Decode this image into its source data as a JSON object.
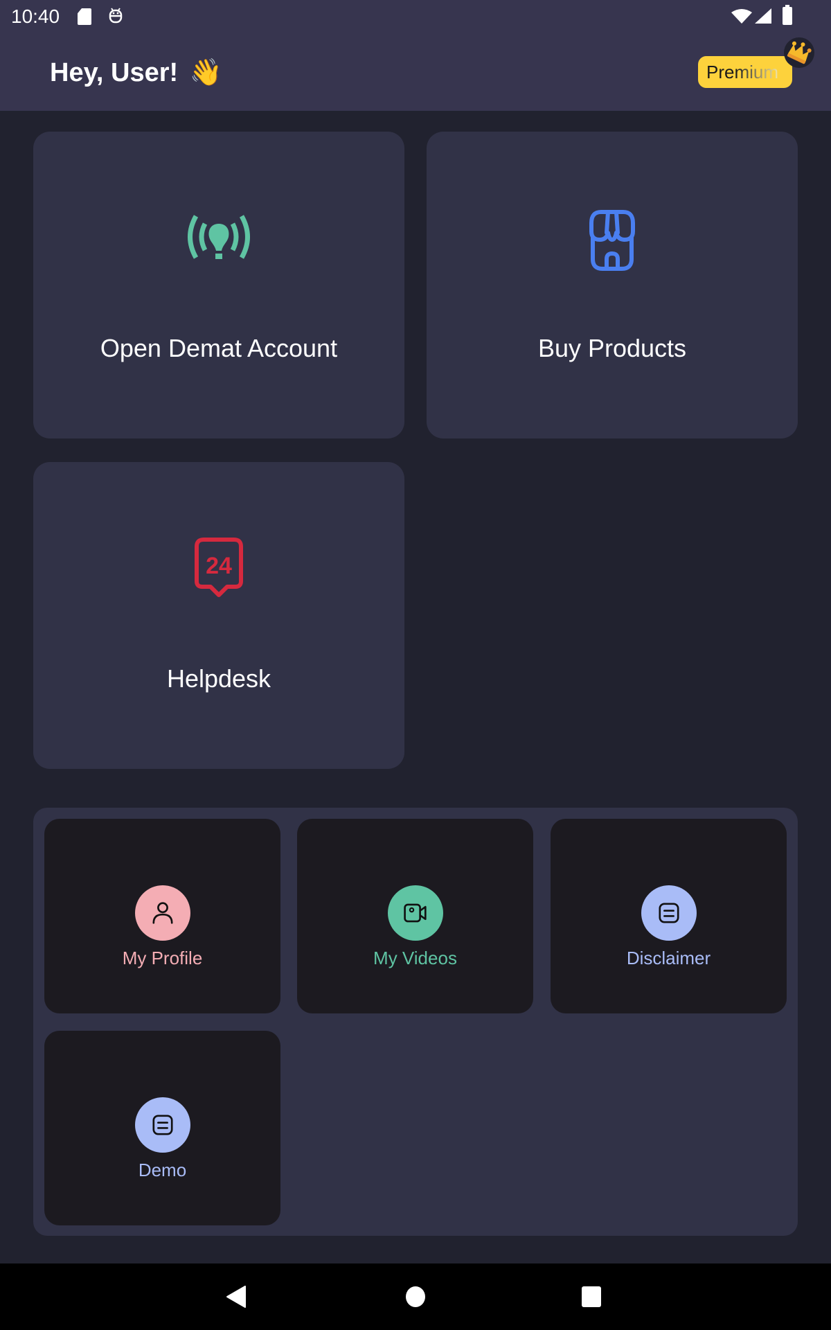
{
  "status_bar": {
    "time": "10:40",
    "icons": [
      "sd-card-icon",
      "android-debug-icon",
      "wifi-icon",
      "signal-icon",
      "battery-icon"
    ]
  },
  "header": {
    "greeting": "Hey, User!",
    "wave_emoji": "👋",
    "premium_badge": "Premium",
    "badge_icon": "crown-icon"
  },
  "cards": [
    {
      "label": "Open Demat Account",
      "icon": "lightbulb-broadcast-icon",
      "color": "#5fc4a3"
    },
    {
      "label": "Buy Products",
      "icon": "storefront-icon",
      "color": "#4a7ff0"
    },
    {
      "label": "Helpdesk",
      "icon": "support-24-icon",
      "color": "#d6293e"
    }
  ],
  "quick_links": [
    {
      "label": "My Profile",
      "icon": "user-icon",
      "color": "#f4adb4"
    },
    {
      "label": "My Videos",
      "icon": "video-camera-icon",
      "color": "#5fc4a3"
    },
    {
      "label": "Disclaimer",
      "icon": "document-icon",
      "color": "#a9bcf7"
    },
    {
      "label": "Demo",
      "icon": "document-icon",
      "color": "#a9bcf7"
    }
  ],
  "nav_bar": {
    "buttons": [
      "back",
      "home",
      "recents"
    ]
  },
  "colors": {
    "background": "#21222f",
    "header": "#37354f",
    "card": "#313247",
    "tile": "#1c1a20",
    "premium": "#fdd23c"
  }
}
